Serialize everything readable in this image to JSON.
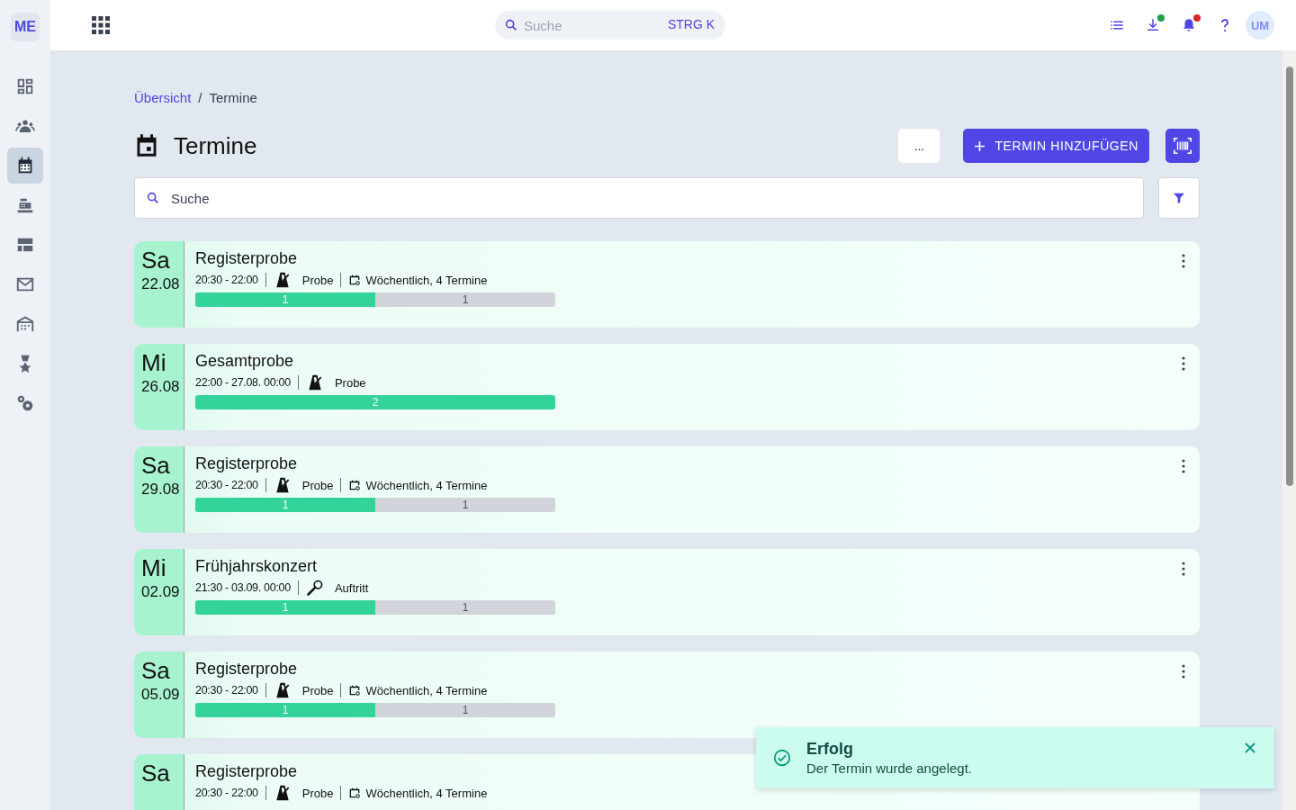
{
  "logo": "ME",
  "sidebar": {
    "items": [
      {
        "kind": "dashboard",
        "selected": false
      },
      {
        "kind": "people",
        "selected": false
      },
      {
        "kind": "calendar",
        "selected": true
      },
      {
        "kind": "register",
        "selected": false
      },
      {
        "kind": "layout",
        "selected": false
      },
      {
        "kind": "mail",
        "selected": false
      },
      {
        "kind": "building",
        "selected": false
      },
      {
        "kind": "award",
        "selected": false
      },
      {
        "kind": "settings",
        "selected": false
      }
    ]
  },
  "topbar": {
    "search": {
      "placeholder": "Suche",
      "shortcut": "STRG K"
    },
    "icons": [
      {
        "kind": "list"
      },
      {
        "kind": "download",
        "color": "#16a34a"
      },
      {
        "kind": "bell",
        "color": "#dc2626"
      },
      {
        "kind": "help"
      }
    ],
    "avatar": "UM"
  },
  "breadcrumb": {
    "items": [
      "Übersicht",
      "Termine"
    ],
    "separator": "/"
  },
  "page_title": "Termine",
  "actions": {
    "more": "...",
    "add": "TERMIN HINZUFÜGEN"
  },
  "search": {
    "placeholder": "Suche"
  },
  "events": [
    {
      "weekday": "Sa",
      "date": "22.08",
      "title": "Registerprobe",
      "time": "20:30 - 22:00",
      "type": {
        "kind": "rehearsal",
        "label": "Probe"
      },
      "recurrence": "Wöchentlich, 4 Termine",
      "level": 0.5,
      "done": "1",
      "open": "1"
    },
    {
      "weekday": "Mi",
      "date": "26.08",
      "title": "Gesamtprobe",
      "time": "22:00 - 27.08. 00:00",
      "type": {
        "kind": "rehearsal",
        "label": "Probe"
      },
      "level": 1,
      "done": "2"
    },
    {
      "weekday": "Sa",
      "date": "29.08",
      "title": "Registerprobe",
      "time": "20:30 - 22:00",
      "type": {
        "kind": "rehearsal",
        "label": "Probe"
      },
      "recurrence": "Wöchentlich, 4 Termine",
      "level": 0.5,
      "done": "1",
      "open": "1"
    },
    {
      "weekday": "Mi",
      "date": "02.09",
      "title": "Frühjahrskonzert",
      "time": "21:30 - 03.09. 00:00",
      "type": {
        "kind": "performance",
        "label": "Auftritt"
      },
      "level": 0.5,
      "done": "1",
      "open": "1"
    },
    {
      "weekday": "Sa",
      "date": "05.09",
      "title": "Registerprobe",
      "time": "20:30 - 22:00",
      "type": {
        "kind": "rehearsal",
        "label": "Probe"
      },
      "recurrence": "Wöchentlich, 4 Termine",
      "level": 0.5,
      "done": "1",
      "open": "1"
    },
    {
      "weekday": "Sa",
      "title": "Registerprobe",
      "time": "20:30 - 22:00",
      "type": {
        "kind": "rehearsal",
        "label": "Probe"
      },
      "recurrence": "Wöchentlich, 4 Termine"
    }
  ],
  "toast": {
    "title": "Erfolg",
    "message": "Der Termin wurde angelegt."
  }
}
